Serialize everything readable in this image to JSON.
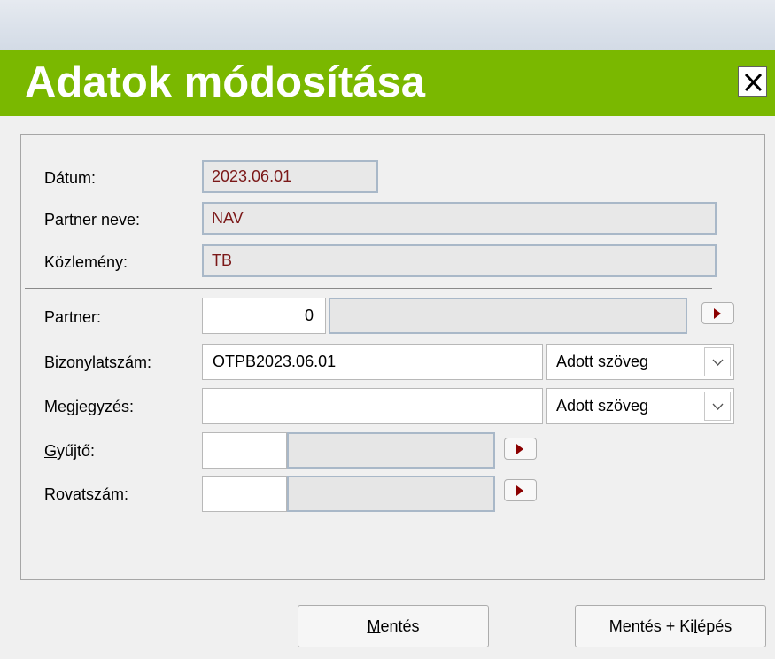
{
  "window": {
    "title": "Adatok módosítása",
    "close_icon": "close-icon"
  },
  "info": {
    "datum_label": "Dátum:",
    "datum_value": "2023.06.01",
    "partner_neve_label": "Partner neve:",
    "partner_neve_value": "NAV",
    "kozlemeny_label": "Közlemény:",
    "kozlemeny_value": "TB"
  },
  "form": {
    "partner_label": "Partner:",
    "partner_code": "0",
    "partner_name": "",
    "bizonylatszam_label": "Bizonylatszám:",
    "bizonylatszam_value": "OTPB2023.06.01",
    "bizonylatszam_mode": "Adott szöveg",
    "megjegyzes_label": "Megjegyzés:",
    "megjegyzes_value": "",
    "megjegyzes_mode": "Adott szöveg",
    "gyujto_label_pre": "",
    "gyujto_label_u": "G",
    "gyujto_label_post": "yűjtő:",
    "gyujto_code": "",
    "gyujto_name": "",
    "rovatszam_label": "Rovatszám:",
    "rovatszam_code": "",
    "rovatszam_name": ""
  },
  "buttons": {
    "save_u": "M",
    "save_rest": "entés",
    "save_exit_pre": "Mentés + Ki",
    "save_exit_u": "l",
    "save_exit_post": "épés"
  },
  "colors": {
    "title_bar": "#7ab800",
    "readonly_text": "#7b1818",
    "arrow": "#8b0000"
  }
}
